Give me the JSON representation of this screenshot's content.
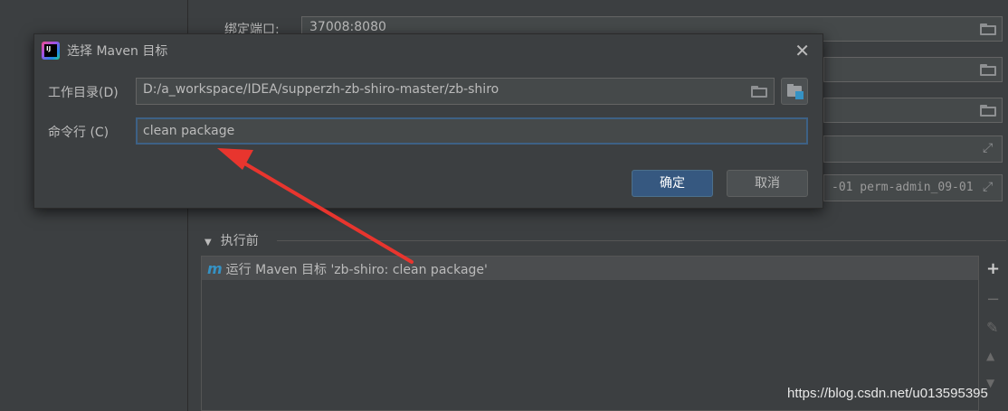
{
  "background": {
    "top_label": "绑定端口:",
    "top_value": "37008:8080",
    "cmd_value": "-01 perm-admin_09-01"
  },
  "before_launch": {
    "title": "执行前",
    "task": "运行 Maven 目标 'zb-shiro: clean package'",
    "task_icon": "m"
  },
  "side_tools": {
    "add": "+",
    "remove": "−"
  },
  "watermark": "https://blog.csdn.net/u013595395",
  "dialog": {
    "title": "选择 Maven 目标",
    "close": "✕",
    "workdir_label": "工作目录(D)",
    "workdir_value": "D:/a_workspace/IDEA/supperzh-zb-shiro-master/zb-shiro",
    "cmd_label": "命令行 (C)",
    "cmd_value": "clean package",
    "ok_label": "确定",
    "cancel_label": "取消",
    "app_icon_text": "IJ"
  },
  "colors": {
    "background": "#3c3f41",
    "ok_button": "#365880",
    "focus_border": "#3d6185",
    "arrow": "#e8352e",
    "maven_icon": "#3592c4"
  }
}
